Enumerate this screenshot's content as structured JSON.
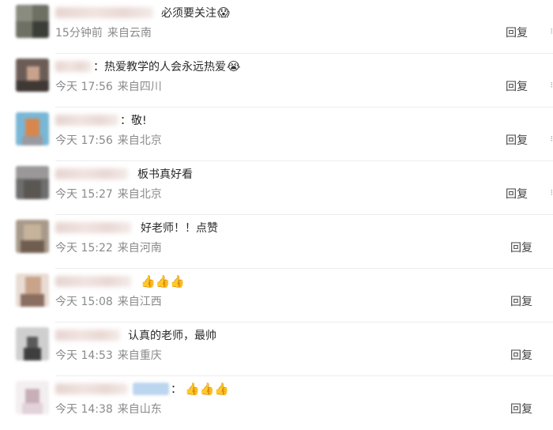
{
  "comments": [
    {
      "text": "必须要关注",
      "emoji": "😱",
      "time": "15分钟前",
      "location": "来自云南",
      "reply": "回复",
      "more": "⁝"
    },
    {
      "text": "：热爱教学的人会永远热爱",
      "emoji": "😭",
      "time": "今天 17:56",
      "location": "来自四川",
      "reply": "回复",
      "more": "⁝"
    },
    {
      "text": "：敬!",
      "emoji": "",
      "time": "今天 17:56",
      "location": "来自北京",
      "reply": "回复",
      "more": "⁝"
    },
    {
      "text": "板书真好看",
      "emoji": "",
      "time": "今天 15:27",
      "location": "来自北京",
      "reply": "回复",
      "more": "⁝"
    },
    {
      "text": "好老师！！点赞",
      "emoji": "",
      "time": "今天 15:22",
      "location": "来自河南",
      "reply": "回复",
      "more": ""
    },
    {
      "text": "",
      "emoji": "👍👍👍",
      "time": "今天 15:08",
      "location": "来自江西",
      "reply": "回复",
      "more": ""
    },
    {
      "text": "认真的老师，最帅",
      "emoji": "",
      "time": "今天 14:53",
      "location": "来自重庆",
      "reply": "回复",
      "more": ""
    },
    {
      "text": "：",
      "emoji": "👍👍👍",
      "time": "今天 14:38",
      "location": "来自山东",
      "reply": "回复",
      "more": ""
    }
  ]
}
